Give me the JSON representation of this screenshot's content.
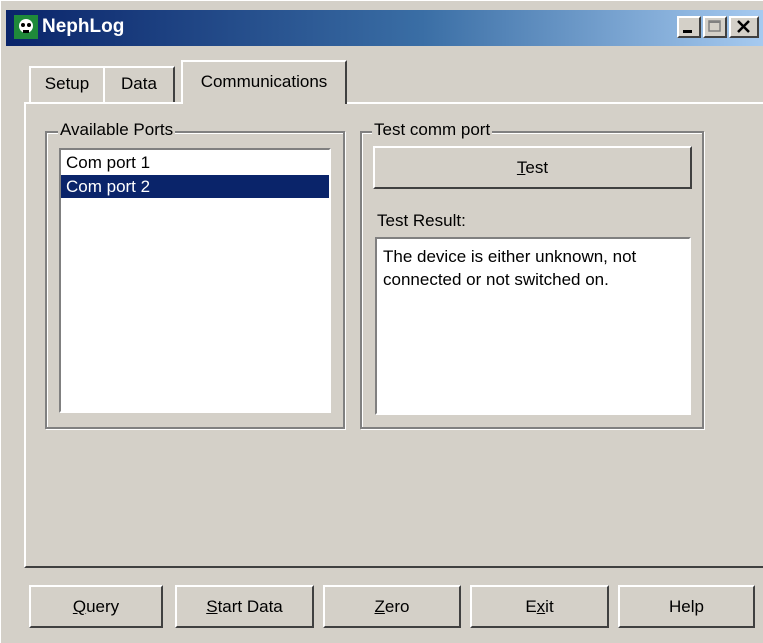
{
  "window": {
    "title": "NephLog",
    "icon": "nephlog-app-icon",
    "controls": [
      "minimize",
      "maximize",
      "close"
    ]
  },
  "tabs": [
    {
      "label": "Setup",
      "active": false
    },
    {
      "label": "Data",
      "active": false
    },
    {
      "label": "Communications",
      "active": true
    }
  ],
  "available_ports": {
    "legend": "Available Ports",
    "items": [
      "Com port 1",
      "Com port 2"
    ],
    "selected": "Com port 2"
  },
  "test_comm_port": {
    "legend": "Test comm port",
    "button_first": "T",
    "button_rest": "est",
    "result_label": "Test Result:",
    "result_text": "The device is either unknown, not connected or not switched on."
  },
  "footer": {
    "query_first": "Q",
    "query_rest": "uery",
    "start_first": "S",
    "start_rest": "tart Data",
    "zero_first": "Z",
    "zero_rest": "ero",
    "exit_first": "E",
    "exit_mid": "x",
    "exit_rest": "it",
    "help": "Help"
  },
  "colors": {
    "face": "#d4d0c8",
    "selection": "#0a246a",
    "title_start": "#0a246a",
    "title_end": "#a6caf0"
  }
}
